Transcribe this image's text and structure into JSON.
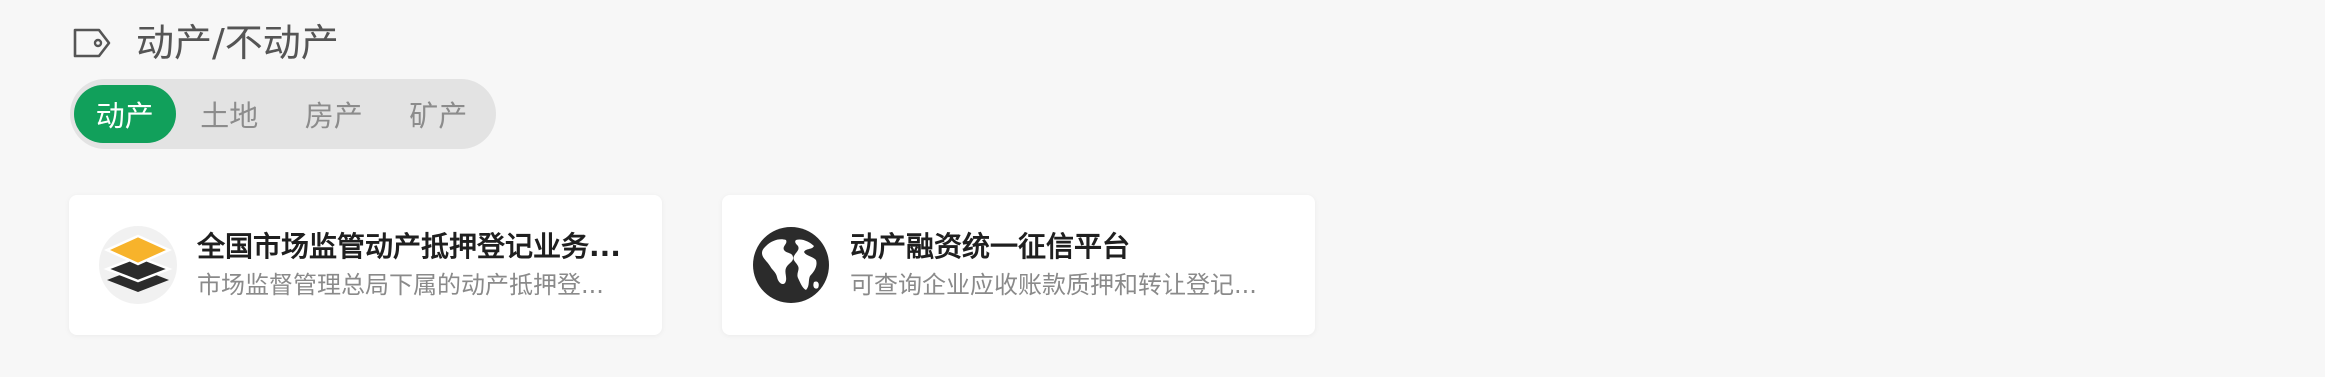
{
  "section": {
    "icon": "tag-icon",
    "title": "动产/不动产"
  },
  "tabs": [
    {
      "label": "动产",
      "active": true
    },
    {
      "label": "土地",
      "active": false
    },
    {
      "label": "房产",
      "active": false
    },
    {
      "label": "矿产",
      "active": false
    }
  ],
  "colors": {
    "accent": "#11a05b",
    "tab_track": "#e3e3e3",
    "background": "#f7f7f7"
  },
  "cards": [
    {
      "icon": "stacked-layers-icon",
      "title": "全国市场监管动产抵押登记业务...",
      "description": "市场监督管理总局下属的动产抵押登..."
    },
    {
      "icon": "globe-icon",
      "title": "动产融资统一征信平台",
      "description": "可查询企业应收账款质押和转让登记..."
    }
  ]
}
